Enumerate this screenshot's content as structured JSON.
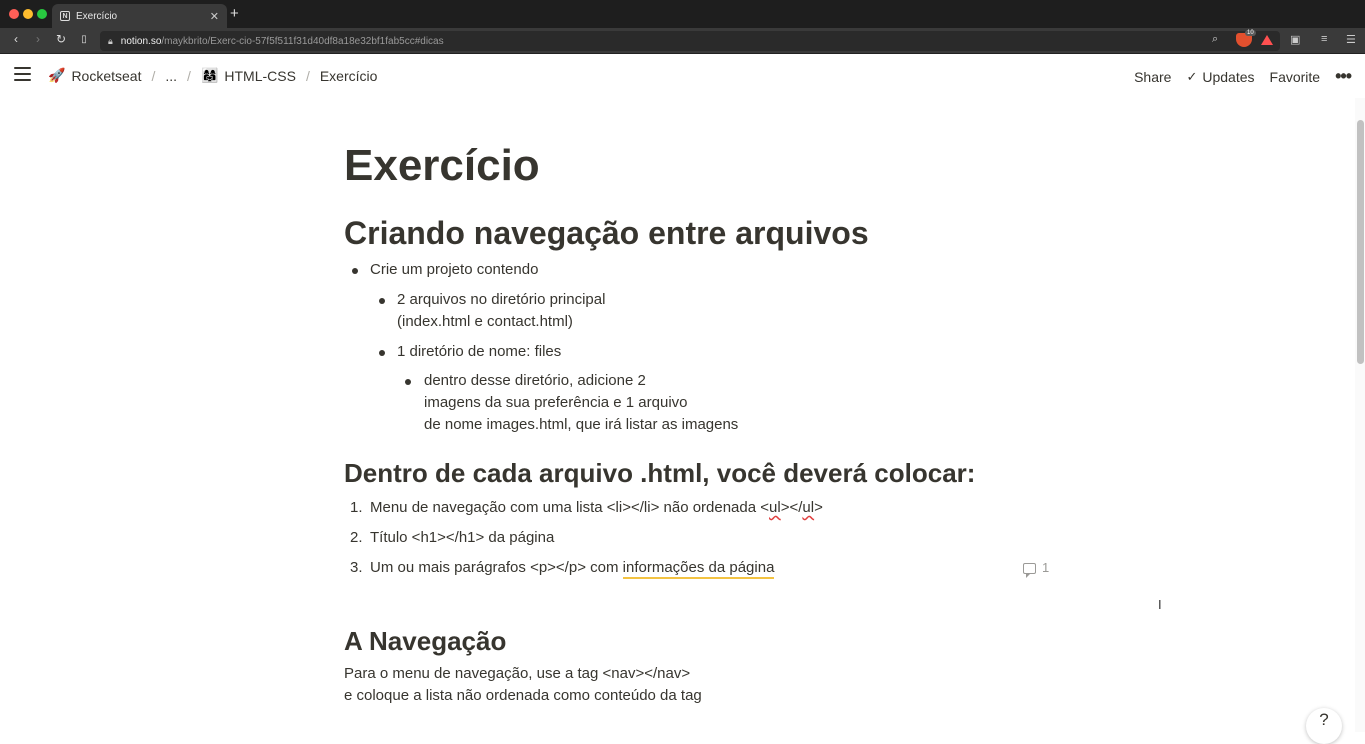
{
  "browser": {
    "tab_title": "Exercício",
    "url_host": "notion.so",
    "url_path": "/maykbrito/Exerc-cio-57f5f511f31d40df8a18e32bf1fab5cc#dicas",
    "brave_shield_count": "10"
  },
  "topbar": {
    "breadcrumb": [
      {
        "emoji": "🚀",
        "label": "Rocketseat"
      },
      {
        "emoji": "",
        "label": "..."
      },
      {
        "emoji": "👩‍👩‍👧",
        "label": "HTML-CSS"
      },
      {
        "emoji": "",
        "label": "Exercício"
      }
    ],
    "separator": "/",
    "share_label": "Share",
    "updates_label": "Updates",
    "favorite_label": "Favorite",
    "more_label": "•••"
  },
  "page": {
    "title": "Exercício",
    "section1": {
      "heading": "Criando navegação entre arquivos",
      "item1": "Crie um projeto contendo",
      "item1a_line1": "2 arquivos no diretório principal",
      "item1a_line2": "(index.html e contact.html)",
      "item1b": "1 diretório de nome: files",
      "item1b1_line1": "dentro desse diretório, adicione 2",
      "item1b1_line2": "imagens da sua preferência e 1 arquivo",
      "item1b1_line3": "de nome images.html, que irá listar as imagens"
    },
    "section2": {
      "heading": "Dentro de cada arquivo .html, você deverá colocar:",
      "items": [
        {
          "num": "1.",
          "pre": "Menu de navegação com uma lista <li></li> não ordenada <",
          "u1": "ul",
          "mid": "></",
          "u2": "ul",
          "post": ">"
        },
        {
          "num": "2.",
          "text": "Título <h1></h1> da página"
        },
        {
          "num": "3.",
          "pre": "Um ou mais parágrafos <p></p> com ",
          "highlight": "informações da página",
          "comment_count": "1"
        }
      ]
    },
    "section3": {
      "heading": "A Navegação",
      "line1": "Para o menu de navegação, use a tag <nav></nav>",
      "line2": "e coloque a lista não ordenada como conteúdo da tag"
    }
  },
  "help_label": "?"
}
